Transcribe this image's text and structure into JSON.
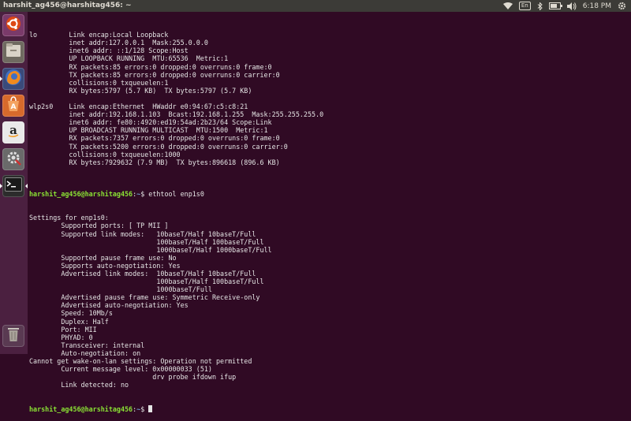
{
  "window": {
    "title": "harshit_ag456@harshitag456: ~"
  },
  "tray": {
    "keyboard": "En",
    "time": "6:18 PM"
  },
  "launcher": {
    "items": [
      {
        "name": "dash-home"
      },
      {
        "name": "files"
      },
      {
        "name": "firefox"
      },
      {
        "name": "software-center"
      },
      {
        "name": "amazon"
      },
      {
        "name": "system-settings"
      },
      {
        "name": "terminal"
      },
      {
        "name": "trash"
      }
    ]
  },
  "terminal": {
    "user": "harshit_ag456@harshitag456",
    "path": "~",
    "command1": "ethtool enp1s0",
    "lines_before": [
      "lo        Link encap:Local Loopback",
      "          inet addr:127.0.0.1  Mask:255.0.0.0",
      "          inet6 addr: ::1/128 Scope:Host",
      "          UP LOOPBACK RUNNING  MTU:65536  Metric:1",
      "          RX packets:85 errors:0 dropped:0 overruns:0 frame:0",
      "          TX packets:85 errors:0 dropped:0 overruns:0 carrier:0",
      "          collisions:0 txqueuelen:1",
      "          RX bytes:5797 (5.7 KB)  TX bytes:5797 (5.7 KB)",
      "",
      "wlp2s0    Link encap:Ethernet  HWaddr e0:94:67:c5:c8:21",
      "          inet addr:192.168.1.103  Bcast:192.168.1.255  Mask:255.255.255.0",
      "          inet6 addr: fe80::4920:ed19:54ad:2b23/64 Scope:Link",
      "          UP BROADCAST RUNNING MULTICAST  MTU:1500  Metric:1",
      "          RX packets:7357 errors:0 dropped:0 overruns:0 frame:0",
      "          TX packets:5200 errors:0 dropped:0 overruns:0 carrier:0",
      "          collisions:0 txqueuelen:1000",
      "          RX bytes:7929632 (7.9 MB)  TX bytes:896618 (896.6 KB)",
      ""
    ],
    "lines_after": [
      "Settings for enp1s0:",
      "        Supported ports: [ TP MII ]",
      "        Supported link modes:   10baseT/Half 10baseT/Full",
      "                                100baseT/Half 100baseT/Full",
      "                                1000baseT/Half 1000baseT/Full",
      "        Supported pause frame use: No",
      "        Supports auto-negotiation: Yes",
      "        Advertised link modes:  10baseT/Half 10baseT/Full",
      "                                100baseT/Half 100baseT/Full",
      "                                1000baseT/Full",
      "        Advertised pause frame use: Symmetric Receive-only",
      "        Advertised auto-negotiation: Yes",
      "        Speed: 10Mb/s",
      "        Duplex: Half",
      "        Port: MII",
      "        PHYAD: 0",
      "        Transceiver: internal",
      "        Auto-negotiation: on",
      "Cannot get wake-on-lan settings: Operation not permitted",
      "        Current message level: 0x00000033 (51)",
      "                               drv probe ifdown ifup",
      "        Link detected: no"
    ]
  }
}
